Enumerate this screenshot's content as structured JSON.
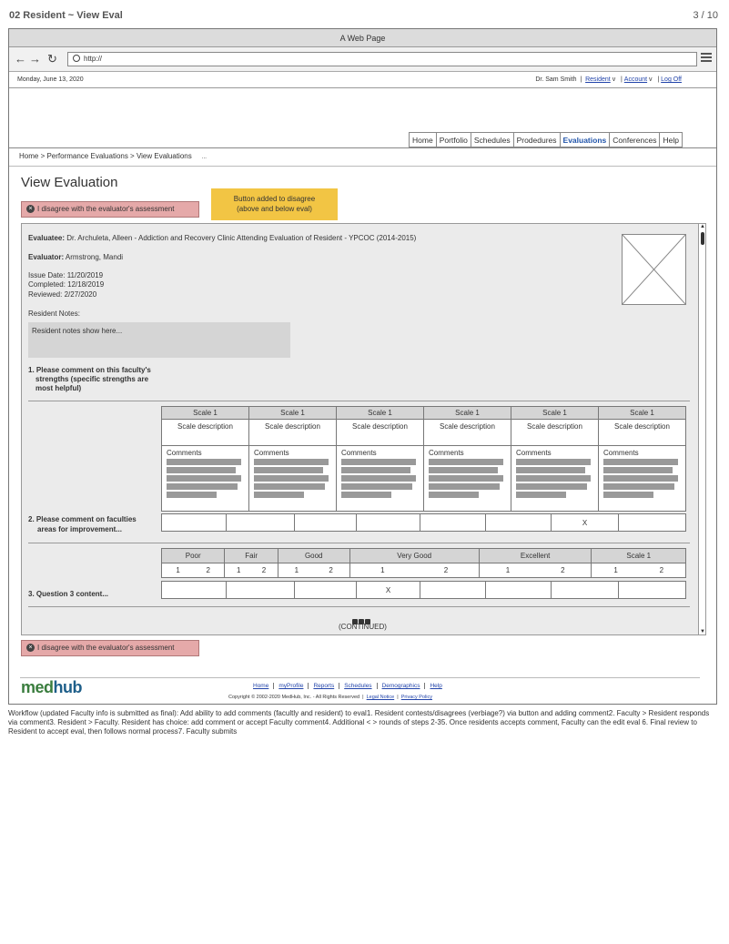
{
  "doc": {
    "title": "02 Resident ~ View Eval",
    "page": "3 / 10"
  },
  "browser": {
    "title": "A Web Page",
    "url": "http://"
  },
  "topbar": {
    "date": "Monday, June 13, 2020",
    "user": "Dr. Sam Smith",
    "role": "Resident",
    "account": "Account",
    "logoff": "Log Off"
  },
  "tabs": [
    "Home",
    "Portfolio",
    "Schedules",
    "Prodedures",
    "Evaluations",
    "Conferences",
    "Help"
  ],
  "active_tab": "Evaluations",
  "breadcrumb": "Home > Performance Evaluations > View Evaluations",
  "breadcrumb_extra": "...",
  "page_title": "View Evaluation",
  "disagree_label": "I disagree with the evaluator's assessment",
  "sticky_note": {
    "line1": "Button added to disagree",
    "line2": "(above and below eval)"
  },
  "eval": {
    "evaluatee_label": "Evaluatee:",
    "evaluatee": "Dr. Archuleta, Alleen - Addiction and Recovery Clinic Attending Evaluation of Resident - YPCOC (2014-2015)",
    "evaluator_label": "Evaluator:",
    "evaluator": "Armstrong, Mandi",
    "issue_date": "Issue Date:  11/20/2019",
    "completed": "Completed:  12/18/2019",
    "reviewed": "Reviewed:  2/27/2020",
    "notes_label": "Resident Notes:",
    "notes": "Resident notes show here...",
    "q1a": "1. Please comment on this faculty's",
    "q1b": "strengths (specific strengths are",
    "q1c": "most helpful)",
    "q2a": "2. Please comment on faculties",
    "q2b": "areas for improvement...",
    "q3": "3. Question 3 content...",
    "continued": "(CONTINUED)"
  },
  "scale_table": {
    "headers": [
      "Scale 1",
      "Scale 1",
      "Scale 1",
      "Scale 1",
      "Scale 1",
      "Scale 1"
    ],
    "descriptions": [
      "Scale description",
      "Scale description",
      "Scale description",
      "Scale description",
      "Scale description",
      "Scale description"
    ],
    "comment_label": "Comments"
  },
  "q2_mark": "X",
  "rating_table": {
    "headers": [
      "Poor",
      "Fair",
      "Good",
      "Very Good",
      "Excellent",
      "Scale 1"
    ],
    "low": "1",
    "high": "2"
  },
  "q3_mark": "X",
  "footer": {
    "logo_med": "med",
    "logo_hub": "hub",
    "links": [
      "Home",
      "myProfile",
      "Reports",
      "Schedules",
      "Demographics",
      "Help"
    ],
    "copyright": "Copyright © 2002-2020 MedHub, Inc. - All Rights Reserved",
    "legal": "Legal Notice",
    "privacy": "Privacy Policy"
  },
  "workflow": "Workflow (updated Faculty info is submitted as final): Add ability to add comments (facultly and resident) to eval1. Resident contests/disagrees (verbiage?) via button and adding comment2. Faculty > Resident responds via comment3. Resident > Faculty. Resident has choice: add comment or accept Faculty comment4. Additional < > rounds of steps 2-35. Once residents accepts comment, Faculty can the edit eval 6. Final review to Resident to accept eval, then follows normal process7. Faculty submits"
}
